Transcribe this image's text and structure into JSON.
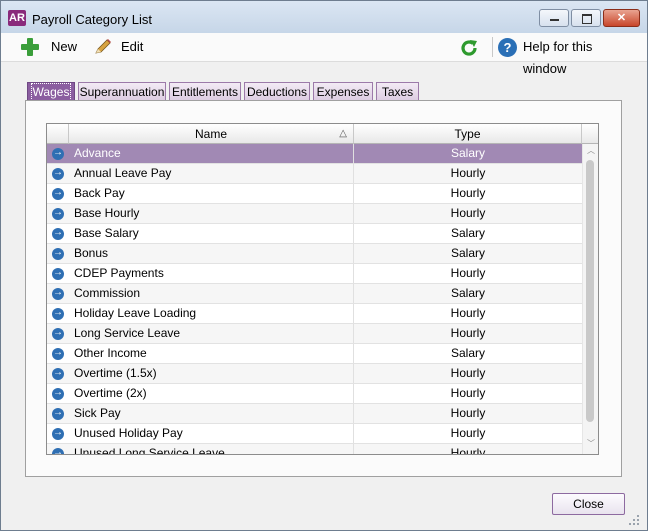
{
  "window": {
    "title": "Payroll Category List",
    "app_badge": "AR"
  },
  "toolbar": {
    "new_label": "New",
    "edit_label": "Edit",
    "help_label": "Help for this window"
  },
  "tabs": [
    {
      "label": "Wages",
      "active": true
    },
    {
      "label": "Superannuation",
      "active": false
    },
    {
      "label": "Entitlements",
      "active": false
    },
    {
      "label": "Deductions",
      "active": false
    },
    {
      "label": "Expenses",
      "active": false
    },
    {
      "label": "Taxes",
      "active": false
    }
  ],
  "grid": {
    "columns": {
      "name": "Name",
      "type": "Type"
    },
    "rows": [
      {
        "name": "Advance",
        "type": "Salary",
        "selected": true
      },
      {
        "name": "Annual Leave Pay",
        "type": "Hourly"
      },
      {
        "name": "Back Pay",
        "type": "Hourly"
      },
      {
        "name": "Base Hourly",
        "type": "Hourly"
      },
      {
        "name": "Base Salary",
        "type": "Salary"
      },
      {
        "name": "Bonus",
        "type": "Salary"
      },
      {
        "name": "CDEP Payments",
        "type": "Hourly"
      },
      {
        "name": "Commission",
        "type": "Salary"
      },
      {
        "name": "Holiday Leave Loading",
        "type": "Hourly"
      },
      {
        "name": "Long Service Leave",
        "type": "Hourly"
      },
      {
        "name": "Other Income",
        "type": "Salary"
      },
      {
        "name": "Overtime (1.5x)",
        "type": "Hourly"
      },
      {
        "name": "Overtime (2x)",
        "type": "Hourly"
      },
      {
        "name": "Sick Pay",
        "type": "Hourly"
      },
      {
        "name": "Unused Holiday Pay",
        "type": "Hourly"
      },
      {
        "name": "Unused Long Service Leave",
        "type": "Hourly"
      }
    ]
  },
  "footer": {
    "close_label": "Close"
  },
  "colors": {
    "accent": "#8b5ea0",
    "selected_row": "#a189b4"
  }
}
